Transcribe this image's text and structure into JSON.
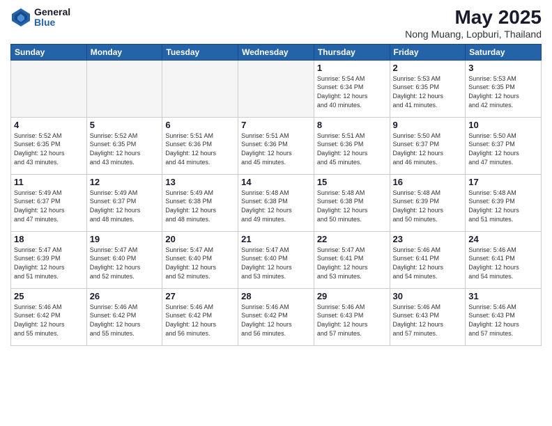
{
  "logo": {
    "general": "General",
    "blue": "Blue"
  },
  "title": "May 2025",
  "location": "Nong Muang, Lopburi, Thailand",
  "days_header": [
    "Sunday",
    "Monday",
    "Tuesday",
    "Wednesday",
    "Thursday",
    "Friday",
    "Saturday"
  ],
  "weeks": [
    [
      {
        "day": "",
        "info": ""
      },
      {
        "day": "",
        "info": ""
      },
      {
        "day": "",
        "info": ""
      },
      {
        "day": "",
        "info": ""
      },
      {
        "day": "1",
        "info": "Sunrise: 5:54 AM\nSunset: 6:34 PM\nDaylight: 12 hours\nand 40 minutes."
      },
      {
        "day": "2",
        "info": "Sunrise: 5:53 AM\nSunset: 6:35 PM\nDaylight: 12 hours\nand 41 minutes."
      },
      {
        "day": "3",
        "info": "Sunrise: 5:53 AM\nSunset: 6:35 PM\nDaylight: 12 hours\nand 42 minutes."
      }
    ],
    [
      {
        "day": "4",
        "info": "Sunrise: 5:52 AM\nSunset: 6:35 PM\nDaylight: 12 hours\nand 43 minutes."
      },
      {
        "day": "5",
        "info": "Sunrise: 5:52 AM\nSunset: 6:35 PM\nDaylight: 12 hours\nand 43 minutes."
      },
      {
        "day": "6",
        "info": "Sunrise: 5:51 AM\nSunset: 6:36 PM\nDaylight: 12 hours\nand 44 minutes."
      },
      {
        "day": "7",
        "info": "Sunrise: 5:51 AM\nSunset: 6:36 PM\nDaylight: 12 hours\nand 45 minutes."
      },
      {
        "day": "8",
        "info": "Sunrise: 5:51 AM\nSunset: 6:36 PM\nDaylight: 12 hours\nand 45 minutes."
      },
      {
        "day": "9",
        "info": "Sunrise: 5:50 AM\nSunset: 6:37 PM\nDaylight: 12 hours\nand 46 minutes."
      },
      {
        "day": "10",
        "info": "Sunrise: 5:50 AM\nSunset: 6:37 PM\nDaylight: 12 hours\nand 47 minutes."
      }
    ],
    [
      {
        "day": "11",
        "info": "Sunrise: 5:49 AM\nSunset: 6:37 PM\nDaylight: 12 hours\nand 47 minutes."
      },
      {
        "day": "12",
        "info": "Sunrise: 5:49 AM\nSunset: 6:37 PM\nDaylight: 12 hours\nand 48 minutes."
      },
      {
        "day": "13",
        "info": "Sunrise: 5:49 AM\nSunset: 6:38 PM\nDaylight: 12 hours\nand 48 minutes."
      },
      {
        "day": "14",
        "info": "Sunrise: 5:48 AM\nSunset: 6:38 PM\nDaylight: 12 hours\nand 49 minutes."
      },
      {
        "day": "15",
        "info": "Sunrise: 5:48 AM\nSunset: 6:38 PM\nDaylight: 12 hours\nand 50 minutes."
      },
      {
        "day": "16",
        "info": "Sunrise: 5:48 AM\nSunset: 6:39 PM\nDaylight: 12 hours\nand 50 minutes."
      },
      {
        "day": "17",
        "info": "Sunrise: 5:48 AM\nSunset: 6:39 PM\nDaylight: 12 hours\nand 51 minutes."
      }
    ],
    [
      {
        "day": "18",
        "info": "Sunrise: 5:47 AM\nSunset: 6:39 PM\nDaylight: 12 hours\nand 51 minutes."
      },
      {
        "day": "19",
        "info": "Sunrise: 5:47 AM\nSunset: 6:40 PM\nDaylight: 12 hours\nand 52 minutes."
      },
      {
        "day": "20",
        "info": "Sunrise: 5:47 AM\nSunset: 6:40 PM\nDaylight: 12 hours\nand 52 minutes."
      },
      {
        "day": "21",
        "info": "Sunrise: 5:47 AM\nSunset: 6:40 PM\nDaylight: 12 hours\nand 53 minutes."
      },
      {
        "day": "22",
        "info": "Sunrise: 5:47 AM\nSunset: 6:41 PM\nDaylight: 12 hours\nand 53 minutes."
      },
      {
        "day": "23",
        "info": "Sunrise: 5:46 AM\nSunset: 6:41 PM\nDaylight: 12 hours\nand 54 minutes."
      },
      {
        "day": "24",
        "info": "Sunrise: 5:46 AM\nSunset: 6:41 PM\nDaylight: 12 hours\nand 54 minutes."
      }
    ],
    [
      {
        "day": "25",
        "info": "Sunrise: 5:46 AM\nSunset: 6:42 PM\nDaylight: 12 hours\nand 55 minutes."
      },
      {
        "day": "26",
        "info": "Sunrise: 5:46 AM\nSunset: 6:42 PM\nDaylight: 12 hours\nand 55 minutes."
      },
      {
        "day": "27",
        "info": "Sunrise: 5:46 AM\nSunset: 6:42 PM\nDaylight: 12 hours\nand 56 minutes."
      },
      {
        "day": "28",
        "info": "Sunrise: 5:46 AM\nSunset: 6:42 PM\nDaylight: 12 hours\nand 56 minutes."
      },
      {
        "day": "29",
        "info": "Sunrise: 5:46 AM\nSunset: 6:43 PM\nDaylight: 12 hours\nand 57 minutes."
      },
      {
        "day": "30",
        "info": "Sunrise: 5:46 AM\nSunset: 6:43 PM\nDaylight: 12 hours\nand 57 minutes."
      },
      {
        "day": "31",
        "info": "Sunrise: 5:46 AM\nSunset: 6:43 PM\nDaylight: 12 hours\nand 57 minutes."
      }
    ]
  ]
}
